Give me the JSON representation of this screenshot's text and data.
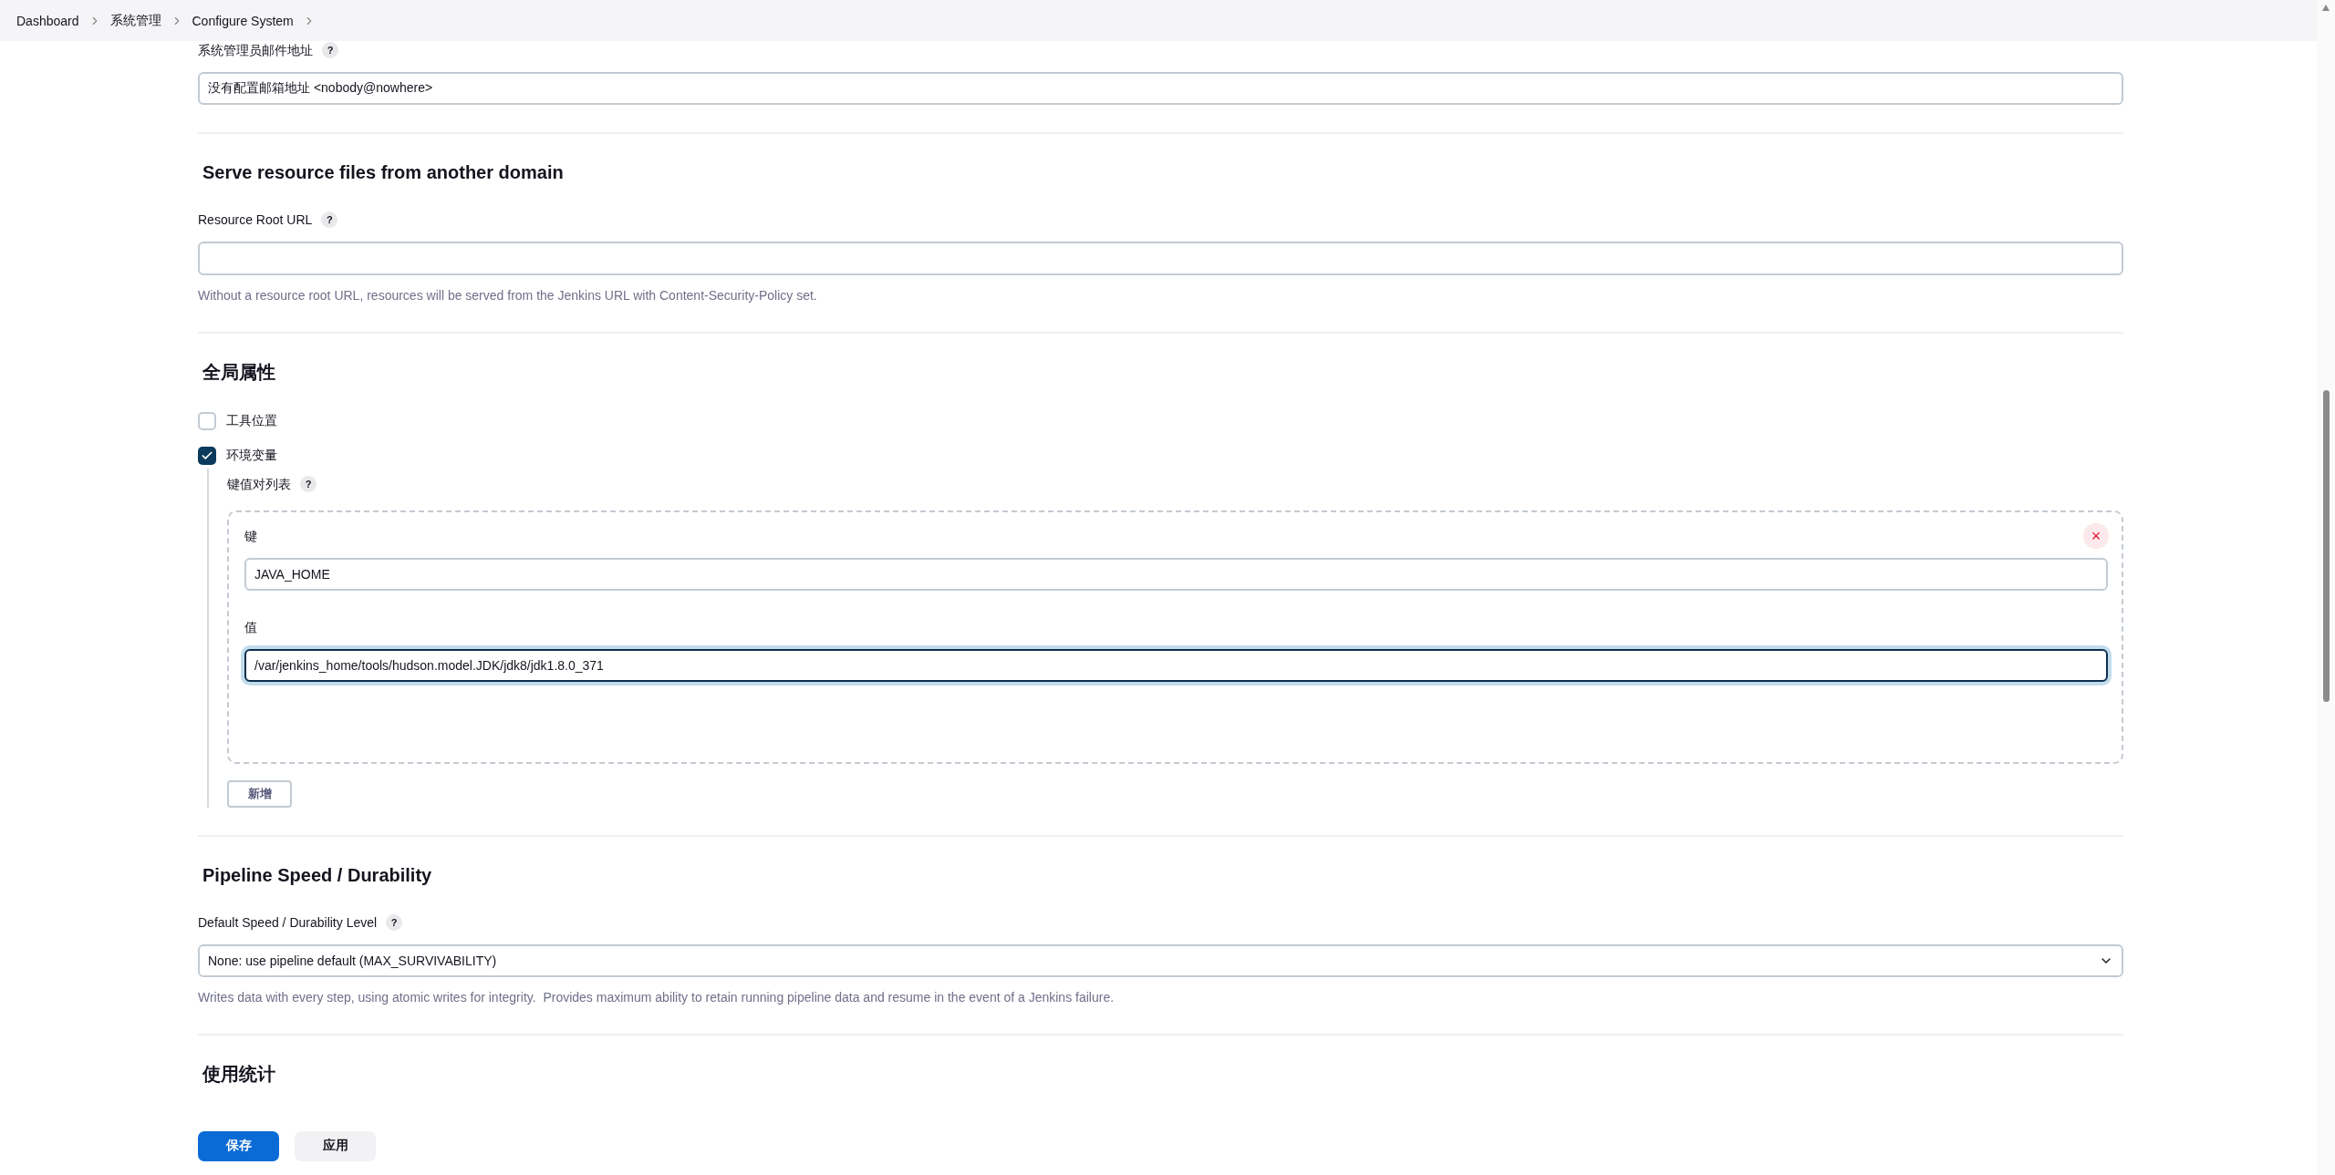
{
  "breadcrumbs": [
    "Dashboard",
    "系统管理",
    "Configure System"
  ],
  "sections": [
    {
      "items": [
        {
          "kind": "text_field",
          "label": "系统管理员邮件地址",
          "help": "?",
          "value": "没有配置邮箱地址 <nobody@nowhere>"
        }
      ]
    },
    {
      "title": "Serve resource files from another domain",
      "items": [
        {
          "kind": "text_field",
          "label": "Resource Root URL",
          "help": "?",
          "description": "Without a resource root URL, resources will be served from the Jenkins URL with Content-Security-Policy set."
        }
      ]
    },
    {
      "title": "全局属性",
      "items": [
        {
          "kind": "checkbox",
          "label": "工具位置",
          "checked": false
        },
        {
          "kind": "checkbox",
          "label": "环境变量",
          "checked": true,
          "list": {
            "label": "键值对列表",
            "help": "?",
            "remove": "×",
            "add_button": "新增",
            "fields": [
              {
                "label": "键",
                "value": "JAVA_HOME",
                "focused": false
              },
              {
                "label": "值",
                "value": "/var/jenkins_home/tools/hudson.model.JDK/jdk8/jdk1.8.0_371",
                "focused": true
              }
            ]
          }
        }
      ]
    },
    {
      "title": "Pipeline Speed / Durability",
      "items": [
        {
          "kind": "select",
          "label": "Default Speed / Durability Level",
          "help": "?",
          "value": "None: use pipeline default (MAX_SURVIVABILITY)",
          "description": "Writes data with every step, using atomic writes for integrity.  Provides maximum ability to retain running pipeline data and resume in the event of a Jenkins failure."
        }
      ]
    },
    {
      "title": "使用统计"
    }
  ],
  "actions": [
    {
      "label": "保存",
      "primary": true
    },
    {
      "label": "应用",
      "primary": false
    }
  ]
}
